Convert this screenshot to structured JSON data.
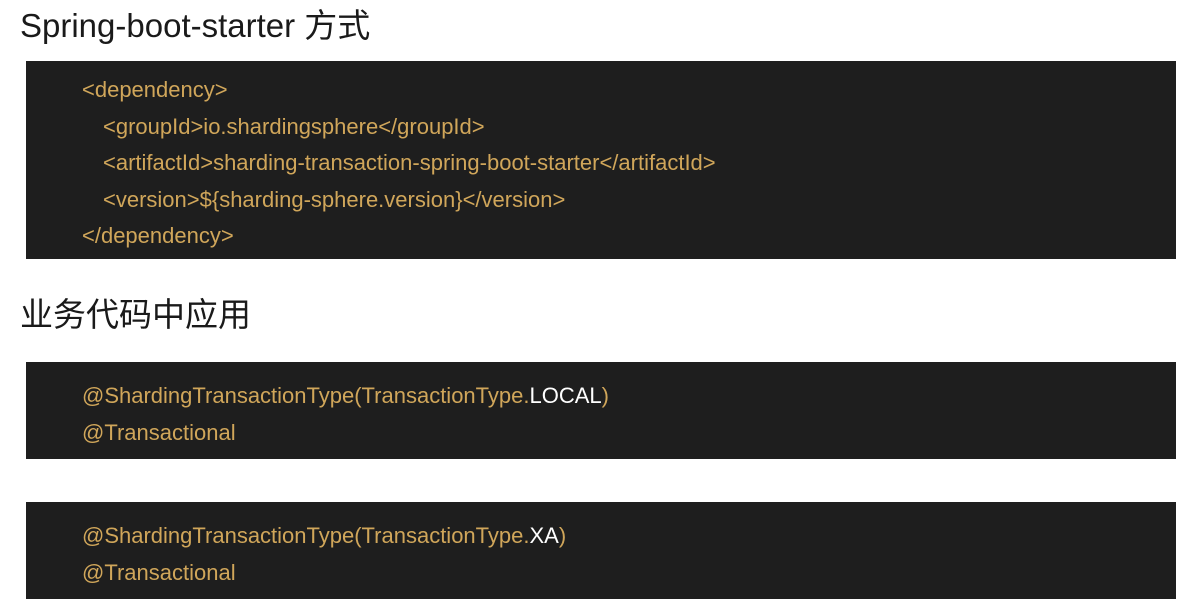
{
  "sections": {
    "starter_heading": "Spring-boot-starter 方式",
    "usage_heading": "业务代码中应用"
  },
  "dependency_block": {
    "open_tag": "<dependency>",
    "group_id": "<groupId>io.shardingsphere</groupId>",
    "artifact_id": "<artifactId>sharding-transaction-spring-boot-starter</artifactId>",
    "version": "<version>${sharding-sphere.version}</version>",
    "close_tag": "</dependency>"
  },
  "local_block": {
    "annotation_prefix": "@ShardingTransactionType(TransactionType.",
    "constant": "LOCAL",
    "annotation_suffix": ")",
    "transactional": "@Transactional"
  },
  "xa_block": {
    "annotation_prefix": "@ShardingTransactionType(TransactionType.",
    "constant": "XA",
    "annotation_suffix": ")",
    "transactional": "@Transactional"
  },
  "colors": {
    "code_background": "#1e1e1e",
    "code_text": "#d0a65a",
    "constant_text": "#ffffff"
  }
}
